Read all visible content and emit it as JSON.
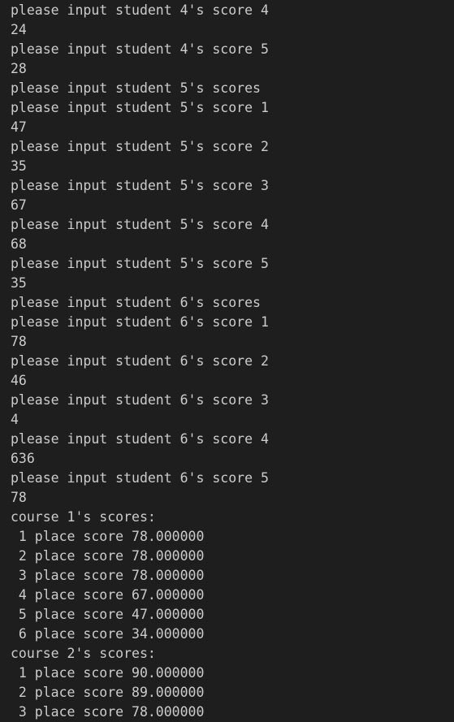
{
  "terminal": {
    "background": "#1e1e1e",
    "foreground": "#cccccc",
    "lines": [
      "please input student 4's score 4",
      "24",
      "please input student 4's score 5",
      "28",
      "please input student 5's scores",
      "please input student 5's score 1",
      "47",
      "please input student 5's score 2",
      "35",
      "please input student 5's score 3",
      "67",
      "please input student 5's score 4",
      "68",
      "please input student 5's score 5",
      "35",
      "please input student 6's scores",
      "please input student 6's score 1",
      "78",
      "please input student 6's score 2",
      "46",
      "please input student 6's score 3",
      "4",
      "please input student 6's score 4",
      "636",
      "please input student 6's score 5",
      "78",
      "course 1's scores:",
      " 1 place score 78.000000",
      " 2 place score 78.000000",
      " 3 place score 78.000000",
      " 4 place score 67.000000",
      " 5 place score 47.000000",
      " 6 place score 34.000000",
      "course 2's scores:",
      " 1 place score 90.000000",
      " 2 place score 89.000000",
      " 3 place score 78.000000"
    ]
  }
}
